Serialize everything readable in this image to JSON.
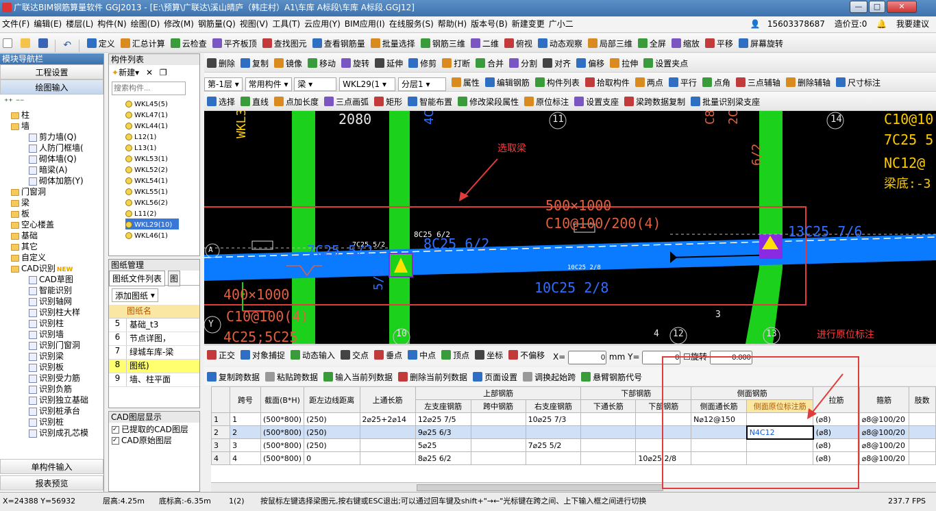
{
  "title": "广联达BIM钢筋算量软件 GGJ2013 - [E:\\预算\\广联达\\溪山晴庐（韩庄村）A1\\车库 A标段\\车库 A标段.GGJ12]",
  "menu": [
    "文件(F)",
    "编辑(E)",
    "楼层(L)",
    "构件(N)",
    "绘图(D)",
    "修改(M)",
    "钢筋量(Q)",
    "视图(V)",
    "工具(T)",
    "云应用(Y)",
    "BIM应用(I)",
    "在线服务(S)",
    "帮助(H)",
    "版本号(B)",
    "新建变更",
    "广小二"
  ],
  "account": {
    "phone": "15603378687",
    "cost_bean": "造价豆:0",
    "help": "我要建议"
  },
  "toolbar1": [
    "定义",
    "汇总计算",
    "云检查",
    "平齐板顶",
    "查找图元",
    "查看钢筋量",
    "批量选择",
    "钢筋三维",
    "二维",
    "俯视",
    "动态观察",
    "局部三维",
    "全屏",
    "缩放",
    "平移",
    "屏幕旋转"
  ],
  "toolbar2": [
    "删除",
    "复制",
    "镜像",
    "移动",
    "旋转",
    "延伸",
    "修剪",
    "打断",
    "合并",
    "分割",
    "对齐",
    "偏移",
    "拉伸",
    "设置夹点"
  ],
  "toolbar3": {
    "floor": "第-1层",
    "type": "常用构件",
    "comp": "梁",
    "name": "WKL29(1",
    "layer": "分层1",
    "items": [
      "属性",
      "编辑钢筋",
      "构件列表",
      "拾取构件",
      "两点",
      "平行",
      "点角",
      "三点辅轴",
      "删除辅轴",
      "尺寸标注"
    ]
  },
  "toolbar4": [
    "选择",
    "直线",
    "点加长度",
    "三点画弧",
    "矩形",
    "智能布置",
    "修改梁段属性",
    "原位标注",
    "设置支座",
    "梁跨数据复制",
    "批量识别梁支座"
  ],
  "left_nav": {
    "title": "模块导航栏",
    "btn1": "工程设置",
    "btn2": "绘图输入",
    "bottom1": "单构件输入",
    "bottom2": "报表预览",
    "tree": [
      {
        "t": "柱",
        "lvl": 1,
        "type": "folder"
      },
      {
        "t": "墙",
        "lvl": 1,
        "type": "folder"
      },
      {
        "t": "剪力墙(Q)",
        "lvl": 2,
        "type": "leaf"
      },
      {
        "t": "人防门框墙(",
        "lvl": 2,
        "type": "leaf"
      },
      {
        "t": "砌体墙(Q)",
        "lvl": 2,
        "type": "leaf"
      },
      {
        "t": "暗梁(A)",
        "lvl": 2,
        "type": "leaf"
      },
      {
        "t": "砌体加筋(Y)",
        "lvl": 2,
        "type": "leaf"
      },
      {
        "t": "门窗洞",
        "lvl": 1,
        "type": "folder"
      },
      {
        "t": "梁",
        "lvl": 1,
        "type": "folder"
      },
      {
        "t": "板",
        "lvl": 1,
        "type": "folder"
      },
      {
        "t": "空心楼盖",
        "lvl": 1,
        "type": "folder"
      },
      {
        "t": "基础",
        "lvl": 1,
        "type": "folder"
      },
      {
        "t": "其它",
        "lvl": 1,
        "type": "folder"
      },
      {
        "t": "自定义",
        "lvl": 1,
        "type": "folder"
      },
      {
        "t": "CAD识别",
        "lvl": 1,
        "type": "folder",
        "badge": "NEW"
      },
      {
        "t": "CAD草图",
        "lvl": 2,
        "type": "leaf"
      },
      {
        "t": "智能识别",
        "lvl": 2,
        "type": "leaf"
      },
      {
        "t": "识别轴网",
        "lvl": 2,
        "type": "leaf"
      },
      {
        "t": "识别柱大样",
        "lvl": 2,
        "type": "leaf"
      },
      {
        "t": "识别柱",
        "lvl": 2,
        "type": "leaf"
      },
      {
        "t": "识别墙",
        "lvl": 2,
        "type": "leaf"
      },
      {
        "t": "识别门窗洞",
        "lvl": 2,
        "type": "leaf"
      },
      {
        "t": "识别梁",
        "lvl": 2,
        "type": "leaf"
      },
      {
        "t": "识别板",
        "lvl": 2,
        "type": "leaf"
      },
      {
        "t": "识别受力筋",
        "lvl": 2,
        "type": "leaf"
      },
      {
        "t": "识别负筋",
        "lvl": 2,
        "type": "leaf"
      },
      {
        "t": "识别独立基础",
        "lvl": 2,
        "type": "leaf"
      },
      {
        "t": "识别桩承台",
        "lvl": 2,
        "type": "leaf"
      },
      {
        "t": "识别桩",
        "lvl": 2,
        "type": "leaf"
      },
      {
        "t": "识别成孔芯模",
        "lvl": 2,
        "type": "leaf"
      }
    ]
  },
  "comp_list": {
    "title": "构件列表",
    "new_btn": "新建",
    "search_ph": "搜索构件...",
    "items": [
      "WKL45(5)",
      "WKL47(1)",
      "WKL44(1)",
      "L12(1)",
      "L13(1)",
      "WKL53(1)",
      "WKL52(2)",
      "WKL54(1)",
      "WKL55(1)",
      "WKL56(2)",
      "L11(2)",
      "WKL29(10)",
      "WKL46(1)"
    ],
    "selected": 11
  },
  "drawing_mgr": {
    "title": "图纸管理",
    "tab1": "图纸文件列表",
    "tab2": "图",
    "add_btn": "添加图纸",
    "col": "图纸名",
    "rows": [
      {
        "n": "5",
        "name": "基础_t3"
      },
      {
        "n": "6",
        "name": "节点详图，"
      },
      {
        "n": "7",
        "name": "绿城车库-梁"
      },
      {
        "n": "8",
        "name": "图纸)"
      },
      {
        "n": "9",
        "name": "墙、柱平面"
      }
    ]
  },
  "cad_layers": {
    "title": "CAD图层显示",
    "items": [
      "已提取的CAD图层",
      "CAD原始图层"
    ]
  },
  "canvas": {
    "annot1": "选取梁",
    "annot2": "进行原位标注",
    "texts": [
      "2080",
      "4C25",
      "WKL35(1)",
      "11",
      "14",
      "C8@100/2",
      "2C25+2C1",
      "6/2",
      "C10@10",
      "7C25 5",
      "NC12@",
      "梁底:-3",
      "500×1000",
      "C10@100/200(4)",
      "13C25 7/6",
      "8C25 6/2",
      "8C25 6/2",
      "7C25 5/2",
      "7C25 5/2",
      "10C25 2/8",
      "10C25 2/8",
      "400×1000",
      "C10@100(4)",
      "4C25;5C25",
      "10",
      "12",
      "13",
      "4",
      "3",
      "Y",
      "A",
      "5/2"
    ]
  },
  "snap_bar": [
    "正交",
    "对象捕捉",
    "动态输入",
    "交点",
    "垂点",
    "中点",
    "顶点",
    "坐标",
    "不偏移"
  ],
  "snap_fields": {
    "x_label": "X=",
    "x_val": "0",
    "unit": "mm",
    "y_label": "Y=",
    "y_val": "0",
    "rot_label": "旋转",
    "rot_val": "0.000"
  },
  "grid_toolbar": [
    "复制跨数据",
    "粘贴跨数据",
    "输入当前列数据",
    "删除当前列数据",
    "页面设置",
    "调换起始跨",
    "悬臂钢筋代号"
  ],
  "grid": {
    "headers_top": [
      "跨号",
      "截面(B*H)",
      "距左边线距离",
      "上通长筋",
      "上部钢筋",
      "下部钢筋",
      "侧面钢筋",
      "拉筋",
      "箍筋",
      "肢数"
    ],
    "sub_top": [
      "左支座钢筋",
      "跨中钢筋",
      "右支座钢筋"
    ],
    "sub_bottom": [
      "下通长筋",
      "下部钢筋"
    ],
    "sub_side": [
      "侧面通长筋",
      "侧面原位标注筋"
    ],
    "rows": [
      [
        "1",
        "1",
        "(500*800)",
        "(250)",
        "2⌀25+2⌀14",
        "12⌀25 7/5",
        "",
        "10⌀25 7/3",
        "",
        "",
        "N⌀12@150",
        "",
        "(⌀8)",
        "⌀8@100/20",
        ""
      ],
      [
        "2",
        "2",
        "(500*800)",
        "(250)",
        "",
        "9⌀25 6/3",
        "",
        "",
        "",
        "",
        "",
        "N4C12",
        "(⌀8)",
        "⌀8@100/20",
        ""
      ],
      [
        "3",
        "3",
        "(500*800)",
        "(250)",
        "",
        "5⌀25",
        "",
        "7⌀25 5/2",
        "",
        "",
        "",
        "",
        "(⌀8)",
        "⌀8@100/20",
        ""
      ],
      [
        "4",
        "4",
        "(500*800)",
        "0",
        "",
        "8⌀25 6/2",
        "",
        "",
        "",
        "10⌀25 2/8",
        "",
        "",
        "(⌀8)",
        "⌀8@100/20",
        ""
      ]
    ]
  },
  "status": {
    "coord": "X=24388 Y=56932",
    "floor_h": "层高:4.25m",
    "bottom_h": "底标高:-6.35m",
    "span": "1(2)",
    "hint": "按鼠标左键选择梁图元,按右键或ESC退出;可以通过回车键及shift+\"→←\"光标键在跨之间、上下输入框之间进行切换",
    "fps": "237.7 FPS"
  },
  "colors": {
    "accent": "#3e72ae",
    "beam": "#0a7bff",
    "column": "#1bd11b",
    "annot": "#e23b3b"
  }
}
